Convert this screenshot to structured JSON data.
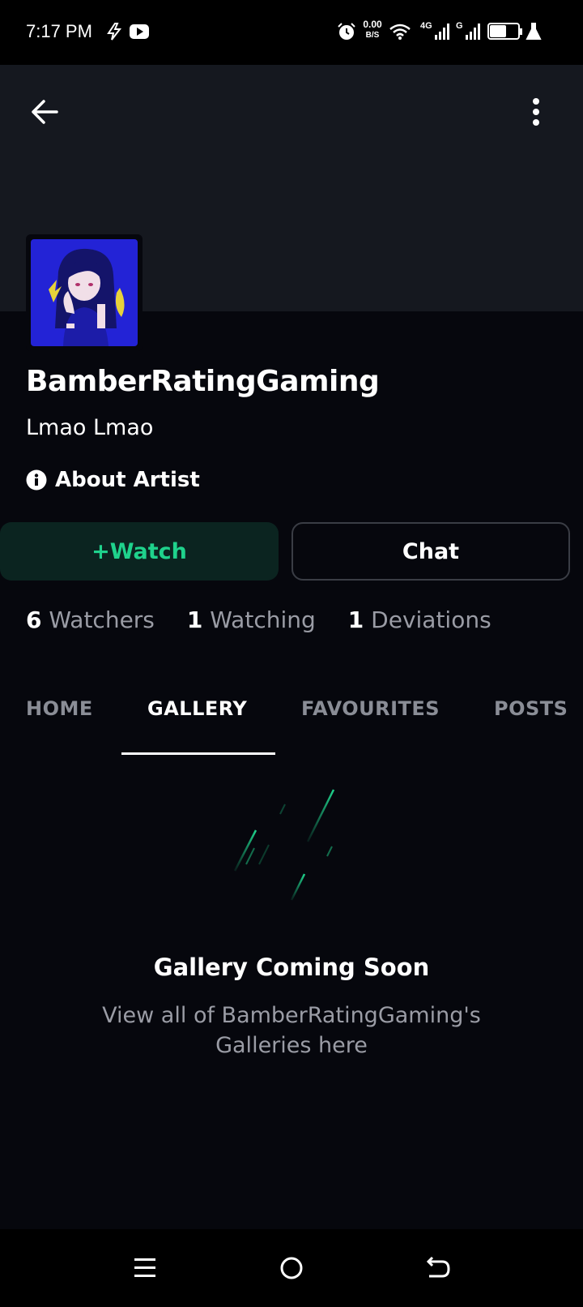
{
  "status_bar": {
    "time": "7:17 PM",
    "network_speed": "0.00",
    "network_speed_unit": "B/S",
    "mobile_1": "4G",
    "mobile_2": "G",
    "battery": "57",
    "icons": [
      "flash-icon",
      "youtube-icon",
      "alarm-icon",
      "wifi-icon",
      "signal-icon",
      "battery-icon",
      "lab-icon"
    ]
  },
  "header": {
    "back_icon": "arrow-left-icon",
    "menu_icon": "more-vertical-icon"
  },
  "profile": {
    "username": "BamberRatingGaming",
    "tagline": "Lmao Lmao",
    "about_label": "About Artist",
    "about_icon": "info-icon"
  },
  "actions": {
    "watch_label": "+Watch",
    "chat_label": "Chat"
  },
  "stats": [
    {
      "count": "6",
      "label": "Watchers"
    },
    {
      "count": "1",
      "label": "Watching"
    },
    {
      "count": "1",
      "label": "Deviations"
    }
  ],
  "tabs": [
    {
      "label": "HOME",
      "active": false
    },
    {
      "label": "GALLERY",
      "active": true
    },
    {
      "label": "FAVOURITES",
      "active": false
    },
    {
      "label": "POSTS",
      "active": false
    }
  ],
  "empty_state": {
    "title": "Gallery Coming Soon",
    "description": "View all of BamberRatingGaming's Galleries here"
  },
  "nav_bar": {
    "icons": [
      "menu-icon",
      "home-icon",
      "back-icon"
    ]
  },
  "colors": {
    "background": "#06070d",
    "banner": "#15181f",
    "accent_green": "#1fd28c",
    "watch_bg": "#0b2420",
    "muted_text": "#9a9ca5"
  }
}
